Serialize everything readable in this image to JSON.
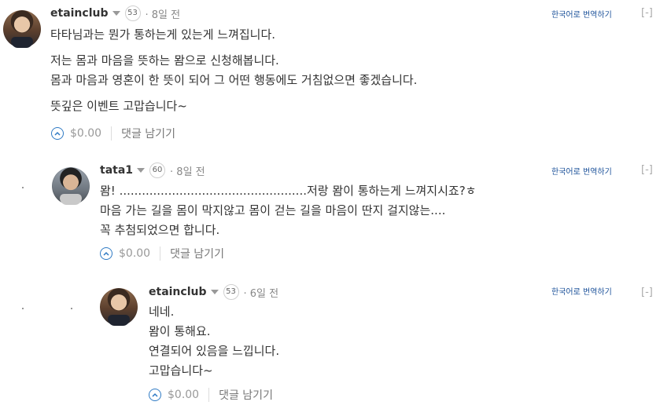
{
  "comments": [
    {
      "author": "etainclub",
      "reputation": "53",
      "time": "· 8일 전",
      "translate": "한국어로 번역하기",
      "collapse": "[-]",
      "paragraphs": [
        "타타님과는 뭔가 통하는게 있는게 느껴집니다.",
        "저는 몸과 마음을 뜻하는 뫔으로 신청해봅니다.\n몸과 마음과 영혼이 한 뜻이 되어 그 어떤 행동에도 거침없으면 좋겠습니다.",
        "뜻깊은 이벤트 고맙습니다~"
      ],
      "payout": "$0.00",
      "reply": "댓글 남기기"
    },
    {
      "author": "tata1",
      "reputation": "60",
      "time": "· 8일 전",
      "translate": "한국어로 번역하기",
      "collapse": "[-]",
      "paragraphs": [
        "뫔! ..................................................저랑 뫔이 통하는게 느껴지시죠?ㅎ\n마음 가는 길을 몸이 막지않고 몸이 걷는 길을 마음이 딴지 걸지않는....\n꼭 추첨되었으면 합니다."
      ],
      "payout": "$0.00",
      "reply": "댓글 남기기"
    },
    {
      "author": "etainclub",
      "reputation": "53",
      "time": "· 6일 전",
      "translate": "한국어로 번역하기",
      "collapse": "[-]",
      "paragraphs": [
        "네네.\n뫔이 통해요.\n연결되어 있음을 느낍니다.\n고맙습니다~"
      ],
      "payout": "$0.00",
      "reply": "댓글 남기기"
    }
  ]
}
